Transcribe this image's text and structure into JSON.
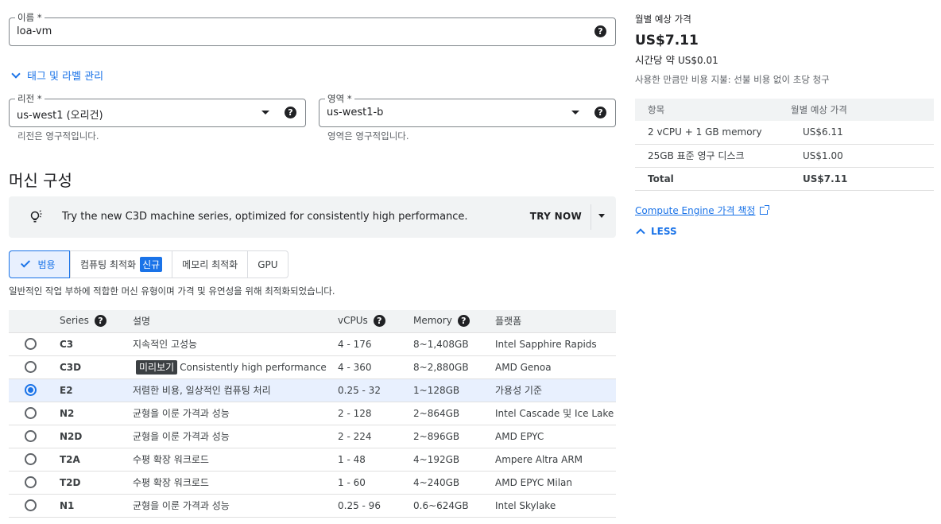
{
  "name_field": {
    "label": "이름 *",
    "value": "loa-vm"
  },
  "tags_toggle": {
    "label": "태그 및 라벨 관리"
  },
  "region": {
    "label": "리전 *",
    "value": "us-west1 (오리건)",
    "hint": "리전은 영구적입니다."
  },
  "zone": {
    "label": "영역 *",
    "value": "us-west1-b",
    "hint": "영역은 영구적입니다."
  },
  "machine_config": {
    "title": "머신 구성",
    "banner": {
      "text": "Try the new C3D machine series, optimized for consistently high performance.",
      "action": "TRY NOW"
    },
    "families": [
      {
        "label": "범용",
        "selected": true
      },
      {
        "label": "컴퓨팅 최적화",
        "badge": "신규"
      },
      {
        "label": "메모리 최적화"
      },
      {
        "label": "GPU"
      }
    ],
    "family_desc": "일반적인 작업 부하에 적합한 머신 유형이며 가격 및 유연성을 위해 최적화되었습니다.",
    "table": {
      "headers": {
        "series": "Series",
        "desc": "설명",
        "vcpus": "vCPUs",
        "memory": "Memory",
        "platform": "플랫폼"
      },
      "rows": [
        {
          "series": "C3",
          "desc": "지속적인 고성능",
          "vcpus": "4 - 176",
          "memory": "8~1,408GB",
          "platform": "Intel Sapphire Rapids",
          "selected": false
        },
        {
          "series": "C3D",
          "preview": "미리보기",
          "desc": "Consistently high performance",
          "vcpus": "4 - 360",
          "memory": "8~2,880GB",
          "platform": "AMD Genoa",
          "selected": false
        },
        {
          "series": "E2",
          "desc": "저렴한 비용, 일상적인 컴퓨팅 처리",
          "vcpus": "0.25 - 32",
          "memory": "1~128GB",
          "platform": "가용성 기준",
          "selected": true
        },
        {
          "series": "N2",
          "desc": "균형을 이룬 가격과 성능",
          "vcpus": "2 - 128",
          "memory": "2~864GB",
          "platform": "Intel Cascade 및 Ice Lake",
          "selected": false
        },
        {
          "series": "N2D",
          "desc": "균형을 이룬 가격과 성능",
          "vcpus": "2 - 224",
          "memory": "2~896GB",
          "platform": "AMD EPYC",
          "selected": false
        },
        {
          "series": "T2A",
          "desc": "수평 확장 워크로드",
          "vcpus": "1 - 48",
          "memory": "4~192GB",
          "platform": "Ampere Altra ARM",
          "selected": false
        },
        {
          "series": "T2D",
          "desc": "수평 확장 워크로드",
          "vcpus": "1 - 60",
          "memory": "4~240GB",
          "platform": "AMD EPYC Milan",
          "selected": false
        },
        {
          "series": "N1",
          "desc": "균형을 이룬 가격과 성능",
          "vcpus": "0.25 - 96",
          "memory": "0.6~624GB",
          "platform": "Intel Skylake",
          "selected": false
        }
      ]
    }
  },
  "pricing": {
    "title": "월별 예상 가격",
    "monthly": "US$7.11",
    "hourly_prefix": "시간당 약",
    "hourly_value": "US$0.01",
    "note": "사용한 만큼만 비용 지불: 선불 비용 없이 초당 청구",
    "table": {
      "headers": {
        "item": "항목",
        "price": "월별 예상 가격"
      },
      "rows": [
        {
          "item": "2 vCPU + 1 GB memory",
          "price": "US$6.11"
        },
        {
          "item": "25GB 표준 영구 디스크",
          "price": "US$1.00"
        },
        {
          "item": "Total",
          "price": "US$7.11"
        }
      ]
    },
    "link": "Compute Engine 가격 책정",
    "less": "LESS"
  },
  "colors": {
    "accent": "#1a73e8",
    "selected_row": "#e8f0fe",
    "banner_bg": "#f1f3f4"
  }
}
